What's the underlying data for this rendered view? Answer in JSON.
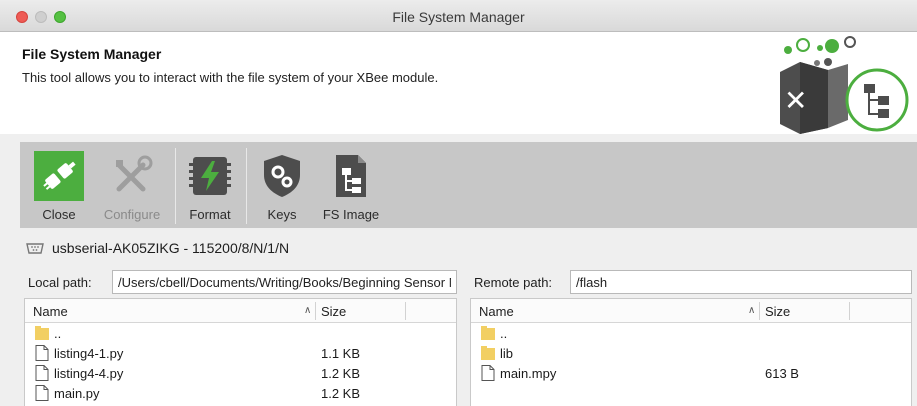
{
  "window": {
    "title": "File System Manager"
  },
  "header": {
    "title": "File System Manager",
    "description": "This tool allows you to interact with the file system of your XBee module."
  },
  "toolbar": {
    "buttons": [
      {
        "label": "Close",
        "icon": "connect-plug-icon",
        "enabled": true
      },
      {
        "label": "Configure",
        "icon": "wrench-screwdriver-icon",
        "enabled": false
      },
      {
        "label": "Format",
        "icon": "format-chip-icon",
        "enabled": true
      },
      {
        "label": "Keys",
        "icon": "shield-gear-icon",
        "enabled": true
      },
      {
        "label": "FS Image",
        "icon": "fs-image-icon",
        "enabled": true
      }
    ]
  },
  "connection": {
    "text": "usbserial-AK05ZIKG - 115200/8/N/1/N",
    "icon": "serial-port-icon"
  },
  "local": {
    "path_label": "Local path:",
    "path_value": "/Users/cbell/Documents/Writing/Books/Beginning Sensor Networks",
    "columns": {
      "name": "Name",
      "size": "Size"
    },
    "files": [
      {
        "name": "..",
        "size": "",
        "type": "folder"
      },
      {
        "name": "listing4-1.py",
        "size": "1.1 KB",
        "type": "file"
      },
      {
        "name": "listing4-4.py",
        "size": "1.2 KB",
        "type": "file"
      },
      {
        "name": "main.py",
        "size": "1.2 KB",
        "type": "file"
      }
    ]
  },
  "remote": {
    "path_label": "Remote path:",
    "path_value": "/flash",
    "columns": {
      "name": "Name",
      "size": "Size"
    },
    "files": [
      {
        "name": "..",
        "size": "",
        "type": "folder"
      },
      {
        "name": "lib",
        "size": "",
        "type": "folder"
      },
      {
        "name": "main.mpy",
        "size": "613 B",
        "type": "file"
      }
    ]
  },
  "colors": {
    "accent_green": "#4cae3f",
    "toolbar_bg": "#c7c7c7",
    "folder_yellow": "#f2cf63"
  }
}
